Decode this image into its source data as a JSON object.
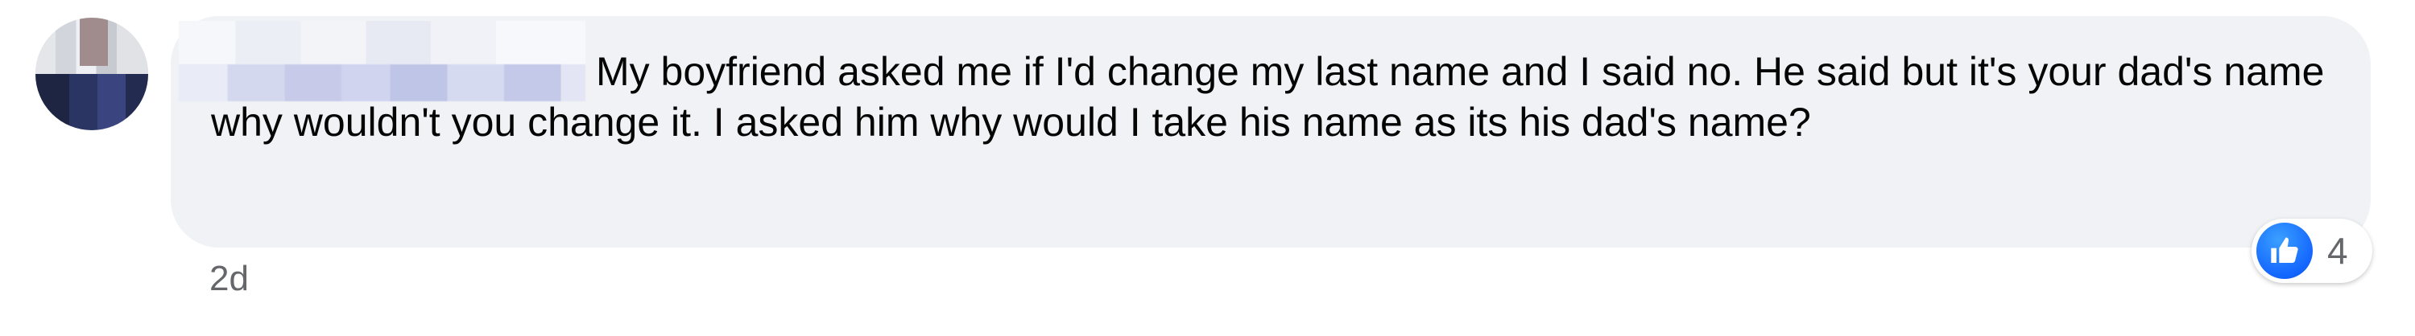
{
  "comment": {
    "text": "My boyfriend asked me if I'd change my last name and I said no. He said but it's your dad's name why wouldn't you change it. I asked him why would I take his name as its his dad's name?",
    "timestamp": "2d"
  },
  "reactions": {
    "icon": "like-icon",
    "count": "4",
    "like_color": "#1877f2"
  },
  "colors": {
    "bubble": "#f0f2f5",
    "text": "#050505",
    "meta": "#65676b"
  }
}
